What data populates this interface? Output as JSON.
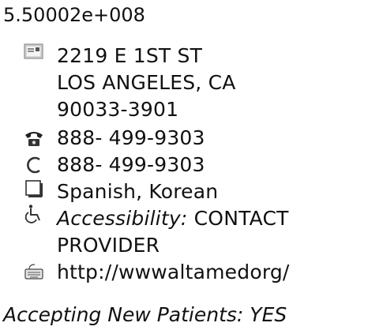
{
  "provider": {
    "id_number": "5.50002e+008",
    "address": {
      "icon": "address-card-icon",
      "street": "2219 E 1ST ST",
      "city_state": "LOS ANGELES, CA",
      "zip": "90033-3901"
    },
    "phone": {
      "icon": "telephone-icon",
      "value": "888- 499-9303"
    },
    "fax": {
      "icon": "fax-icon",
      "value": "888- 499-9303"
    },
    "languages": {
      "icon": "language-icon",
      "value": "Spanish, Korean"
    },
    "accessibility": {
      "icon": "wheelchair-icon",
      "label": "Accessibility:",
      "value_line1": "CONTACT",
      "value_line2": "PROVIDER"
    },
    "website": {
      "icon": "web-keyboard-icon",
      "value": "http://wwwaltamedorg/"
    },
    "accepting_new_patients": "Accepting New Patients: YES"
  }
}
